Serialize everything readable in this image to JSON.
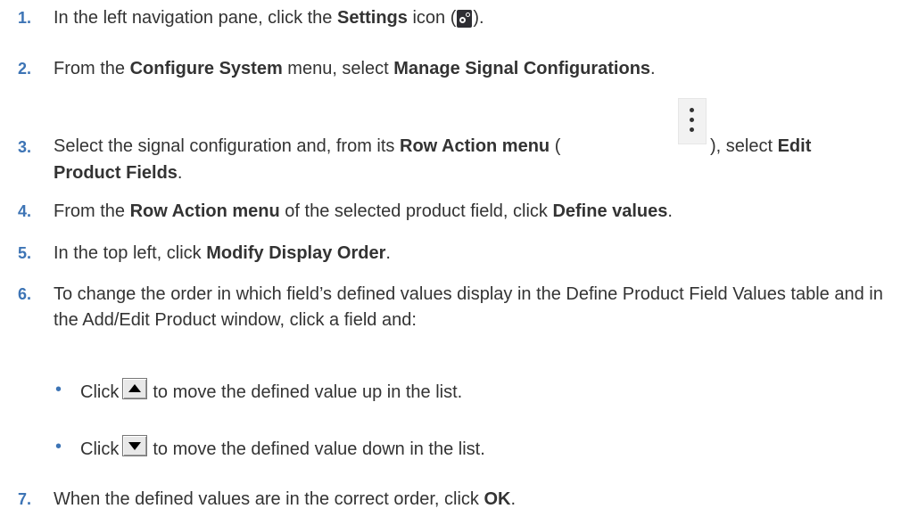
{
  "steps": [
    {
      "num": "1.",
      "a": "In the left navigation pane, click the ",
      "b1": "Settings",
      "c": " icon (",
      "d": ")."
    },
    {
      "num": "2.",
      "a": "From the ",
      "b1": "Configure System",
      "c": " menu, select ",
      "b2": "Manage Signal Configurations",
      "d": "."
    },
    {
      "num": "3.",
      "a": "Select the signal configuration and, from its ",
      "b1": "Row Action menu",
      "c": " (",
      "d": "), select ",
      "b2": "Edit Product Fields",
      "e": "."
    },
    {
      "num": "4.",
      "a": "From the ",
      "b1": "Row Action menu",
      "c": " of the selected product field, click ",
      "b2": "Define values",
      "d": "."
    },
    {
      "num": "5.",
      "a": "In the top left, click ",
      "b1": "Modify Display Order",
      "d": "."
    },
    {
      "num": "6.",
      "a": "To change the order in which field’s defined values display in the Define Product Field Values table and in the Add/Edit Product window, click a field and:"
    },
    {
      "num": "7.",
      "a": "When the defined values are in the correct order, click ",
      "b1": "OK",
      "d": "."
    }
  ],
  "bullets": [
    {
      "mark": "•",
      "pre": "Click",
      "post": "to move the defined value up in the list.",
      "icon": "move-up-icon"
    },
    {
      "mark": "•",
      "pre": "Click",
      "post": "to move the defined value down in the list.",
      "icon": "move-down-icon"
    }
  ],
  "icons": {
    "settings": "settings-icon",
    "row_action": "kebab-menu-icon"
  },
  "colors": {
    "step_number": "#3d74b5",
    "text": "#333333"
  }
}
